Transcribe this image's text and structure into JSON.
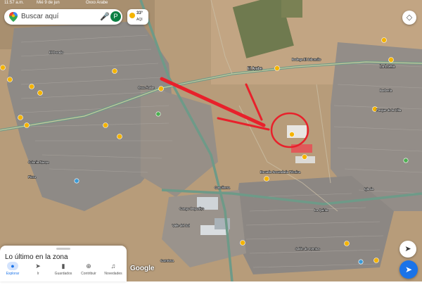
{
  "status_bar": {
    "time": "11:57 a.m.",
    "date": "Mié 9 de jun",
    "place_hint": "Oxxo Arabe"
  },
  "search": {
    "placeholder": "Buscar aquí",
    "avatar_letter": "P"
  },
  "weather": {
    "temp": "33°",
    "aqi": "AQI"
  },
  "map_labels": {
    "main_road_label": "El Arabe",
    "oxxo_label": "Oxxo Arabe",
    "dorado_label": "El Dorado",
    "jaboncito_label": "Bodega El Jaboncito",
    "la_loma_label": "La Loma",
    "barberia_label": "Barbería",
    "parque_label": "Parque de la Villa",
    "escuela_label": "Escuela Secundaria Técnica",
    "pizza_label": "Pizza",
    "gasolinera_label": "Gasolinera",
    "iglesia_label": "Iglesia",
    "campo_label": "Campo Deportivo",
    "valle_label": "Valle del Sol",
    "quinta_label": "La Quinta",
    "salon_label": "Salón de eventos",
    "colonia_label": "Colonia Nueva",
    "aeropuerto_label": "Carretera"
  },
  "attribution": "Google",
  "bottom_sheet": {
    "title": "Lo último en la zona"
  },
  "bottom_nav": [
    {
      "label": "Explorar",
      "icon": "explore-icon"
    },
    {
      "label": "Ir",
      "icon": "go-icon"
    },
    {
      "label": "Guardados",
      "icon": "bookmark-icon"
    },
    {
      "label": "Contribuir",
      "icon": "add-icon"
    },
    {
      "label": "Novedades",
      "icon": "bell-icon"
    }
  ],
  "colors": {
    "annotation_red": "#e8212b",
    "google_blue": "#1a73e8",
    "marker_yellow": "#f5b400"
  }
}
